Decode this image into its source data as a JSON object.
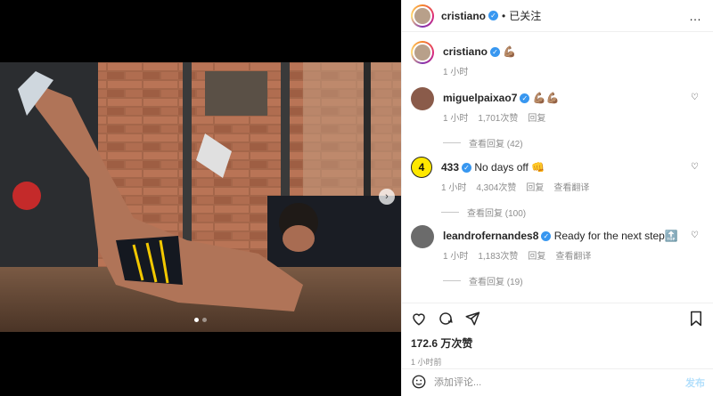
{
  "media": {
    "next_icon": "chevron-right-icon",
    "carousel_index": 1,
    "carousel_total": 2
  },
  "header": {
    "username": "cristiano",
    "separator": "•",
    "follow_label": "已关注",
    "more_icon": "…"
  },
  "caption": {
    "username": "cristiano",
    "text": "💪🏽",
    "time": "1 小时"
  },
  "comments": [
    {
      "username": "miguelpaixao7",
      "text": "💪🏽💪🏽",
      "time": "1 小时",
      "likes": "1,701次赞",
      "reply": "回复",
      "view_replies": "查看回复 (42)"
    },
    {
      "username": "433",
      "avatar_label": "4",
      "text": "No days off 👊",
      "time": "1 小时",
      "likes": "4,304次赞",
      "reply": "回复",
      "translate": "查看翻译",
      "view_replies": "查看回复 (100)"
    },
    {
      "username": "leandrofernandes8",
      "text": "Ready for the next step🔝",
      "time": "1 小时",
      "likes": "1,183次赞",
      "reply": "回复",
      "translate": "查看翻译",
      "view_replies": "查看回复 (19)"
    }
  ],
  "actions": {
    "likes": "172.6 万次赞",
    "time": "1 小时前"
  },
  "add_comment": {
    "placeholder": "添加评论...",
    "post_label": "发布"
  },
  "colors": {
    "verified": "#3897f0",
    "post_disabled": "#b2dffc",
    "muted": "#8e8e8e"
  }
}
